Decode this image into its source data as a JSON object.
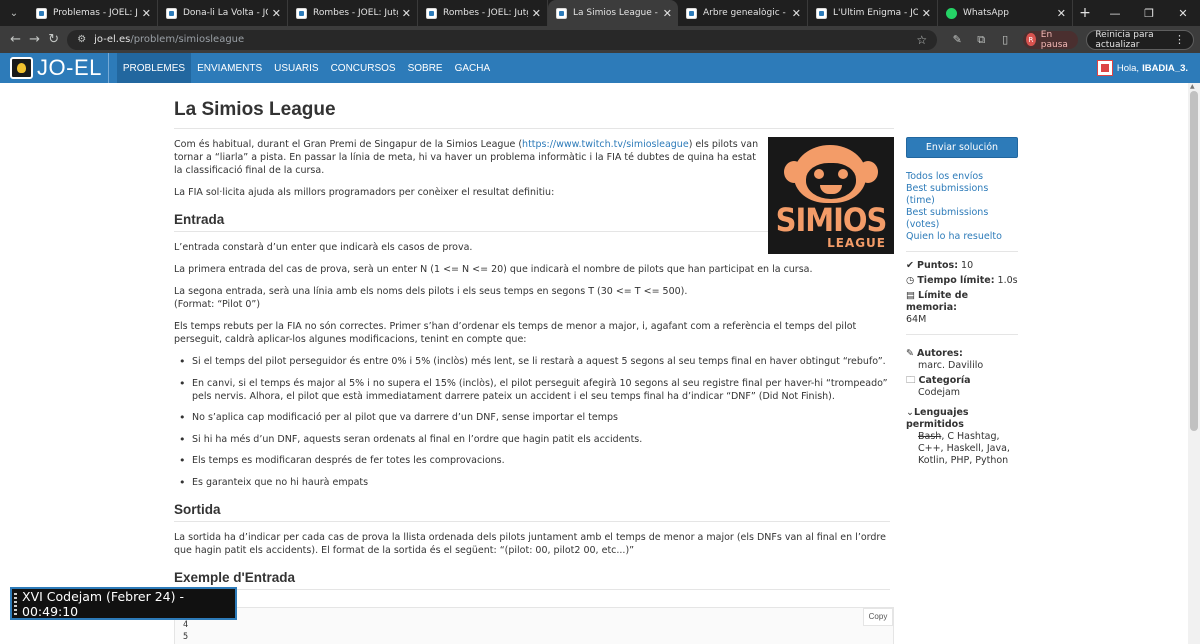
{
  "browser": {
    "tabs": [
      {
        "title": "Problemas - JOEL: Jutge O",
        "icon": "joel-favicon"
      },
      {
        "title": "Dona-li La Volta - JOEL: Ju",
        "icon": "joel-favicon"
      },
      {
        "title": "Rombes - JOEL: Jutge Onl",
        "icon": "joel-favicon"
      },
      {
        "title": "Rombes - JOEL: Jutge Onl",
        "icon": "joel-favicon"
      },
      {
        "title": "La Simios League - JOEL: J",
        "icon": "joel-favicon",
        "active": true
      },
      {
        "title": "Arbre genealògic - JOEL:",
        "icon": "joel-favicon"
      },
      {
        "title": "L'Últim Enigma - JOEL: Ju",
        "icon": "joel-favicon"
      },
      {
        "title": "WhatsApp",
        "icon": "whatsapp-favicon"
      }
    ],
    "url_host": "jo-el.es",
    "url_path": "/problem/simiosleague",
    "profile_initial": "R",
    "pause_label": "En pausa",
    "relaunch_label": "Reinicia para actualizar"
  },
  "site": {
    "logo_text": "JO-EL",
    "nav": [
      "PROBLEMES",
      "ENVIAMENTS",
      "USUARIS",
      "CONCURSOS",
      "SOBRE",
      "GACHA"
    ],
    "greeting": "Hola,",
    "username": "IBADIA_3."
  },
  "problem": {
    "title": "La Simios League",
    "intro_1_pre": "Com és habitual, durant el Gran Premi de Singapur de la Simios League (",
    "intro_1_link": "https://www.twitch.tv/simiosleague",
    "intro_1_post": ") els pilots van tornar a “liarla” a pista. En passar la línia de meta, hi va haver un problema informàtic i la FIA té dubtes de quina ha estat la classificació final de la cursa.",
    "intro_2": "La FIA sol·licita ajuda als millors programadors per conèixer el resultat definitiu:",
    "thumb_word1": "SIMIOS",
    "thumb_word2": "LEAGUE",
    "input_heading": "Entrada",
    "input_p1": "L’entrada constarà d’un enter que indicarà els casos de prova.",
    "input_p2": "La primera entrada del cas de prova, serà un enter N (1 <= N <= 20) que indicarà el nombre de pilots que han participat en la cursa.",
    "input_p3": "La segona entrada, serà una línia amb els noms dels pilots i els seus temps en segons T (30 <= T <= 500).",
    "input_p3_format": "(Format: “Pilot 0”)",
    "input_p4": "Els temps rebuts per la FIA no són correctes. Primer s’han d’ordenar els temps de menor a major, i, agafant com a referència el temps del pilot perseguit, caldrà aplicar-los algunes modificacions, tenint en compte que:",
    "rules": [
      "Si el temps del pilot perseguidor és entre 0% i 5% (inclòs) més lent, se li restarà a aquest 5 segons al seu temps final en haver obtingut “rebufo”.",
      "En canvi, si el temps és major al 5% i no supera el 15% (inclòs), el pilot perseguit afegirà 10 segons al seu registre final per haver-hi “trompeado” pels nervis. Alhora, el pilot que està immediatament darrere pateix un accident i el seu temps final ha d’indicar “DNF” (Did Not Finish).",
      "No s’aplica cap modificació per al pilot que va darrere d’un DNF, sense importar el temps",
      "Si hi ha més d’un DNF, aquests seran ordenats al final en l’ordre que hagin patit els accidents.",
      "Els temps es modificaran després de fer totes les comprovacions.",
      "Es garanteix que no hi haurà empats"
    ],
    "output_heading": "Sortida",
    "output_p1": "La sortida ha d’indicar per cada cas de prova la llista ordenada dels pilots juntament amb el temps de menor a major (els DNFs van al final en l’ordre que hagin patit els accidents). El format de la sortida és el següent: “(pilot: 00, pilot2 00, etc...)”",
    "example_heading": "Exemple d'Entrada",
    "example_lines": [
      "4",
      "5"
    ],
    "copy_label": "Copy"
  },
  "sidebar": {
    "submit_label": "Enviar solución",
    "links": [
      "Todos los envíos",
      "Best submissions (time)",
      "Best submissions (votes)",
      "Quien lo ha resuelto"
    ],
    "points_label": "Puntos:",
    "points_value": "10",
    "time_label": "Tiempo límite:",
    "time_value": "1.0s",
    "memory_label": "Límite de memoria:",
    "memory_value": "64M",
    "authors_label": "Autores:",
    "authors_value": "marc. Davililo",
    "category_label": "Categoría",
    "category_value": "Codejam",
    "languages_label": "Lenguajes permitidos",
    "languages_struck": "Bash",
    "languages_rest": ", C Hashtag, C++, Haskell, Java, Kotlin, PHP, Python"
  },
  "contest": {
    "timer": "XVI Codejam (Febrer 24) - 00:49:10"
  }
}
